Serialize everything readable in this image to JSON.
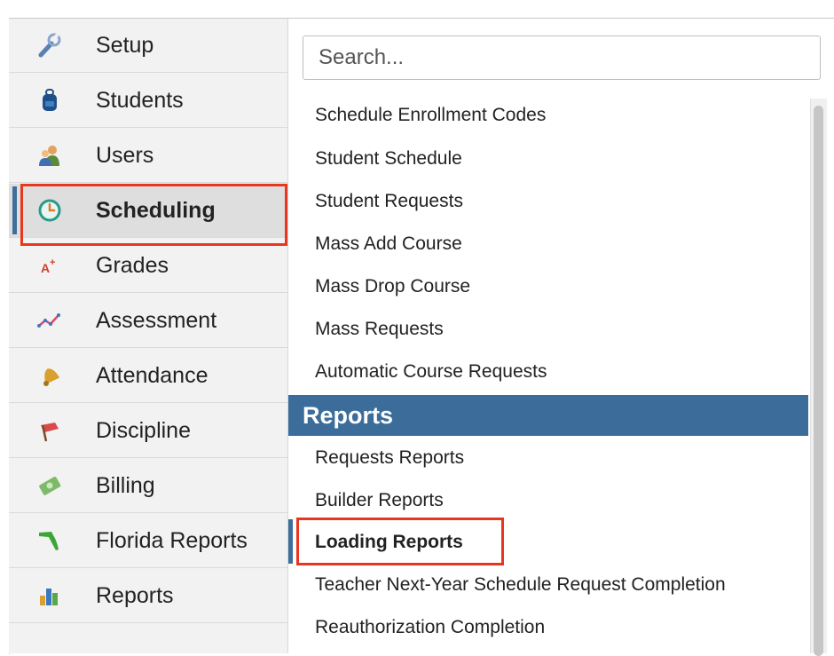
{
  "nav": {
    "items": [
      {
        "label": "Setup",
        "icon": "wrench-icon"
      },
      {
        "label": "Students",
        "icon": "backpack-icon"
      },
      {
        "label": "Users",
        "icon": "users-icon"
      },
      {
        "label": "Scheduling",
        "icon": "clock-icon",
        "active": true
      },
      {
        "label": "Grades",
        "icon": "grade-icon"
      },
      {
        "label": "Assessment",
        "icon": "line-chart-icon"
      },
      {
        "label": "Attendance",
        "icon": "bell-icon"
      },
      {
        "label": "Discipline",
        "icon": "flag-icon"
      },
      {
        "label": "Billing",
        "icon": "money-icon"
      },
      {
        "label": "Florida Reports",
        "icon": "florida-icon"
      },
      {
        "label": "Reports",
        "icon": "bar-chart-icon"
      }
    ]
  },
  "search": {
    "placeholder": "Search..."
  },
  "menu": {
    "links": [
      "Schedule Enrollment Codes",
      "Student Schedule",
      "Student Requests",
      "Mass Add Course",
      "Mass Drop Course",
      "Mass Requests",
      "Automatic Course Requests"
    ],
    "reports_header": "Reports",
    "report_links": [
      "Requests Reports",
      "Builder Reports",
      "Loading Reports",
      "Teacher Next-Year Schedule Request Completion",
      "Reauthorization Completion"
    ]
  },
  "colors": {
    "accent": "#3c6d9a",
    "highlight": "#e8371f"
  }
}
